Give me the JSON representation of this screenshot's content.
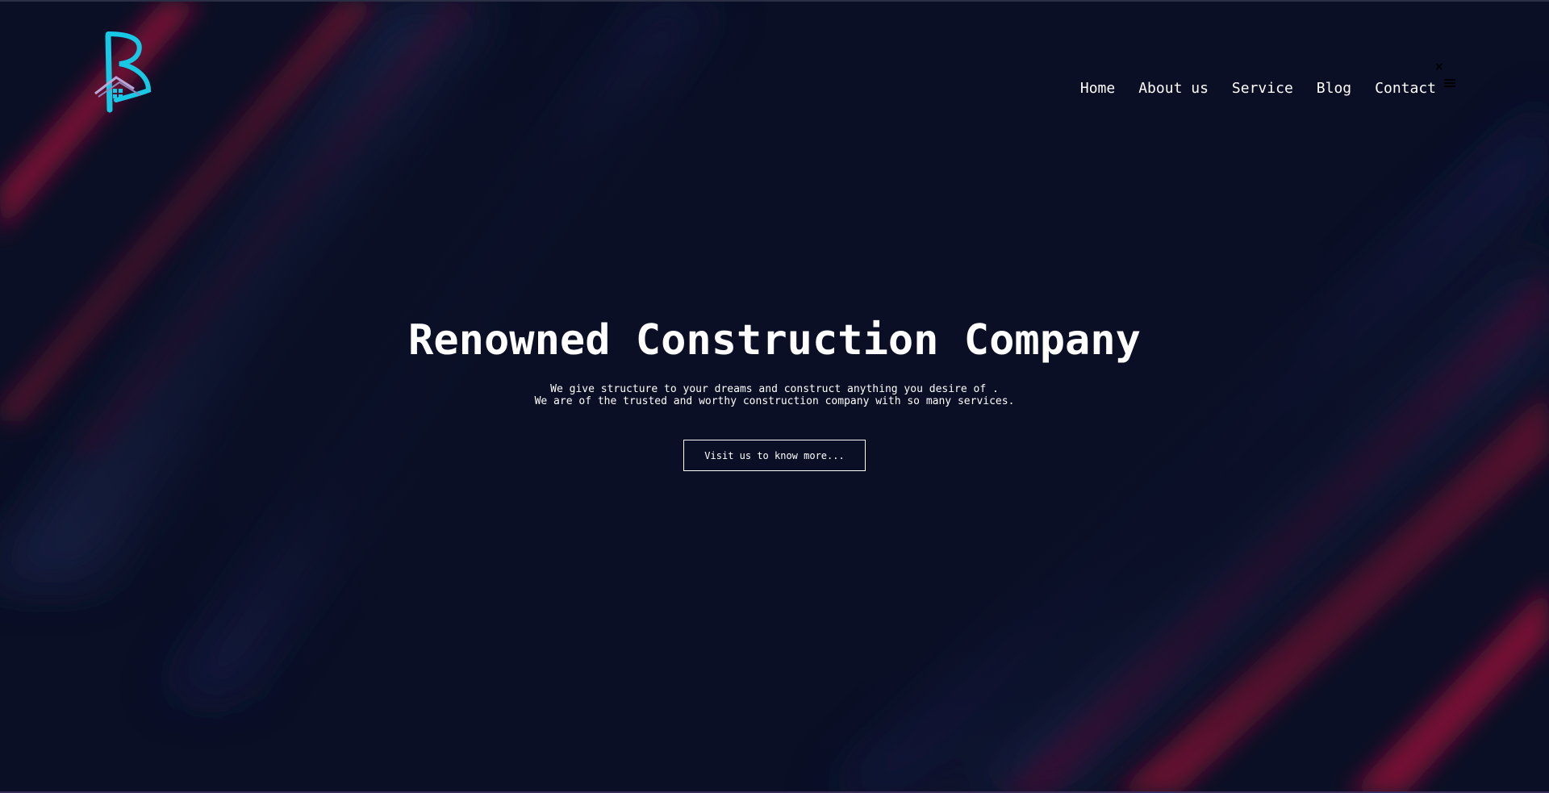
{
  "nav": {
    "items": [
      {
        "label": "Home"
      },
      {
        "label": "About us"
      },
      {
        "label": "Service"
      },
      {
        "label": "Blog"
      },
      {
        "label": "Contact"
      }
    ],
    "close_glyph": "×",
    "close_icon": "close-icon",
    "menu_icon": "hamburger-menu-icon"
  },
  "logo": {
    "icon": "company-logo-icon",
    "colors": {
      "primary": "#18c9e6",
      "secondary": "#b8a8d8"
    }
  },
  "hero": {
    "title": "Renowned Construction Company",
    "subtitle_line1": "We give structure to your dreams and construct anything you desire of .",
    "subtitle_line2": "We are of the trusted and worthy construction company with so many services.",
    "cta_label": "Visit us to know more..."
  },
  "colors": {
    "background": "#0a0f25",
    "streak_red": "#8a1035",
    "streak_blue": "#1a2550",
    "text": "#ffffff"
  }
}
